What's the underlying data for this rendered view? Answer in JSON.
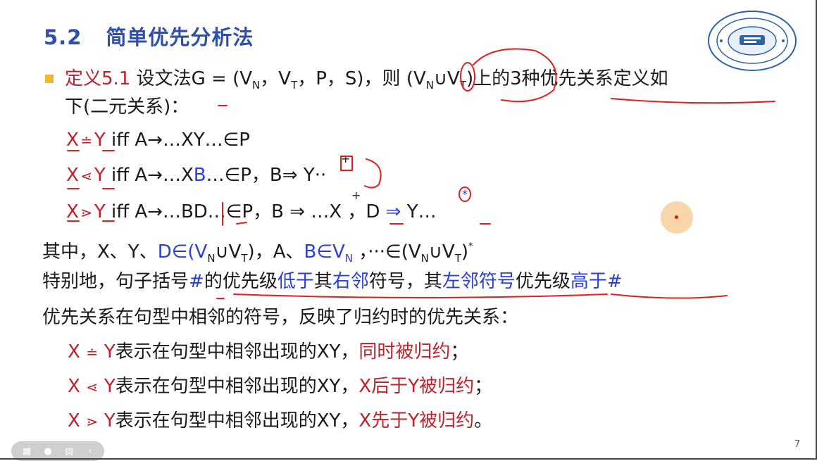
{
  "title": {
    "number": "5.2",
    "text": "简单优先分析法"
  },
  "def": {
    "label": "定义5.1",
    "pre": "设文法G = (V",
    "sub_n": "N",
    "comma1": "，V",
    "sub_t": "T",
    "mid": "，P，S)，则 (V",
    "sub_n2": "N",
    "union": "∪V",
    "sub_t2": "T",
    "post": ")上的3种优先关系定义如",
    "cont": "下(二元关系)："
  },
  "rules": [
    {
      "x": "X",
      "rel": "≐",
      "y": "Y",
      "rest": " iff  A→…XY…∈P"
    },
    {
      "x": "X",
      "rel": "⋖",
      "y": "Y",
      "rest_a": " iff  A→…X",
      "b": "B",
      "rest_b": "…∈P，B⇒ Y··",
      "plus": "+"
    },
    {
      "x": "X",
      "rel": "⋗",
      "y": "Y",
      "rest_a": " iff  A→…BD…∈P，B ⇒ …X ，D ",
      "arrow": "⇒",
      "rest_b": " Y…",
      "plus": "+",
      "star": "*"
    }
  ],
  "where": {
    "p1": "其中，X、Y、",
    "d": "D∈(V",
    "dn": "N",
    "du": "∪V",
    "dt": "T",
    "p2": ")，A、",
    "b": "B∈V",
    "bn": "N",
    "p3": " ，···∈(V",
    "p3n": "N",
    "p3u": "∪V",
    "p3t": "T",
    "p4": ")",
    "star": "*"
  },
  "special": {
    "s1": "特别地，句子括号",
    "hash1": "#",
    "s2": "的优先级",
    "low": "低于",
    "s3": "其",
    "right": "右邻",
    "s4": "符号，其",
    "left": "左邻符号",
    "s5": "优先级",
    "high": "高于#"
  },
  "reflect": "优先关系在句型中相邻的符号，反映了归约时的优先关系：",
  "meanings": [
    {
      "x": "X",
      "rel": "≐",
      "y": "Y",
      "text": "表示在句型中相邻出现的XY，",
      "tail": "同时被归约",
      "end": "；"
    },
    {
      "x": "X",
      "rel": "⋖",
      "y": "Y",
      "text": "表示在句型中相邻出现的XY，",
      "tail": "X后于Y被归约",
      "end": "；"
    },
    {
      "x": "X",
      "rel": "⋗",
      "y": "Y",
      "text": "表示在句型中相邻出现的XY，",
      "tail": "X先于Y被归约",
      "end": "。"
    }
  ],
  "page_number": "7",
  "colors": {
    "title": "#2f4fae",
    "red": "#c0202a",
    "blue": "#2a3fd8",
    "bullet": "#f2b530"
  }
}
